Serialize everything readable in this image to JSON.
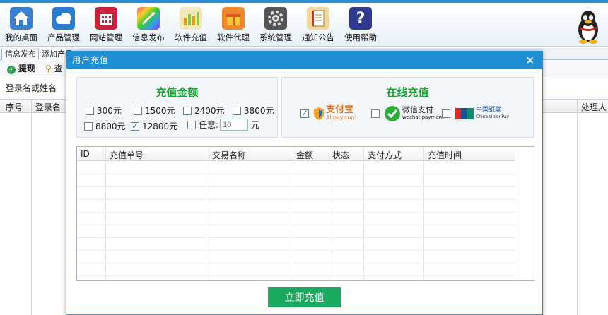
{
  "toolbar": {
    "items": [
      {
        "label": "我的桌面",
        "icon": "house-icon"
      },
      {
        "label": "产品管理",
        "icon": "cloud-icon"
      },
      {
        "label": "网站管理",
        "icon": "building-icon"
      },
      {
        "label": "信息发布",
        "icon": "magic-wand-icon"
      },
      {
        "label": "软件充值",
        "icon": "bar-chart-icon"
      },
      {
        "label": "软件代理",
        "icon": "gift-box-icon"
      },
      {
        "label": "系统管理",
        "icon": "gear-icon"
      },
      {
        "label": "通知公告",
        "icon": "notebook-icon"
      },
      {
        "label": "使用帮助",
        "icon": "help-icon"
      }
    ]
  },
  "background": {
    "tabs": [
      "信息发布",
      "添加产品"
    ],
    "withdraw_button": "提现",
    "search_button": "查",
    "search_label": "登录名或姓名",
    "columns": [
      "序号",
      "登录名",
      "处理人"
    ]
  },
  "modal": {
    "title": "用户充值",
    "close": "×",
    "amount_panel": {
      "title": "充值金额",
      "options": [
        {
          "label": "300元",
          "checked": false
        },
        {
          "label": "1500元",
          "checked": false
        },
        {
          "label": "2400元",
          "checked": false
        },
        {
          "label": "3800元",
          "checked": false
        },
        {
          "label": "8800元",
          "checked": false
        },
        {
          "label": "12800元",
          "checked": true
        }
      ],
      "custom_label": "任意:",
      "custom_placeholder": "10",
      "custom_unit": "元"
    },
    "online_panel": {
      "title": "在线充值",
      "methods": [
        {
          "name": "支付宝",
          "sub": "Alipay.com",
          "checked": true
        },
        {
          "name": "微信支付",
          "sub": "wechat payment",
          "checked": false
        },
        {
          "name": "中国银联",
          "sub": "China UnionPay",
          "checked": false
        }
      ]
    },
    "table": {
      "columns": [
        "ID",
        "充值单号",
        "交易名称",
        "金额",
        "状态",
        "支付方式",
        "充值时间"
      ]
    },
    "submit": "立即充值"
  },
  "colors": {
    "accent": "#1d8fd2",
    "title_green": "#1aa033",
    "submit_green": "#1aaa5f"
  }
}
